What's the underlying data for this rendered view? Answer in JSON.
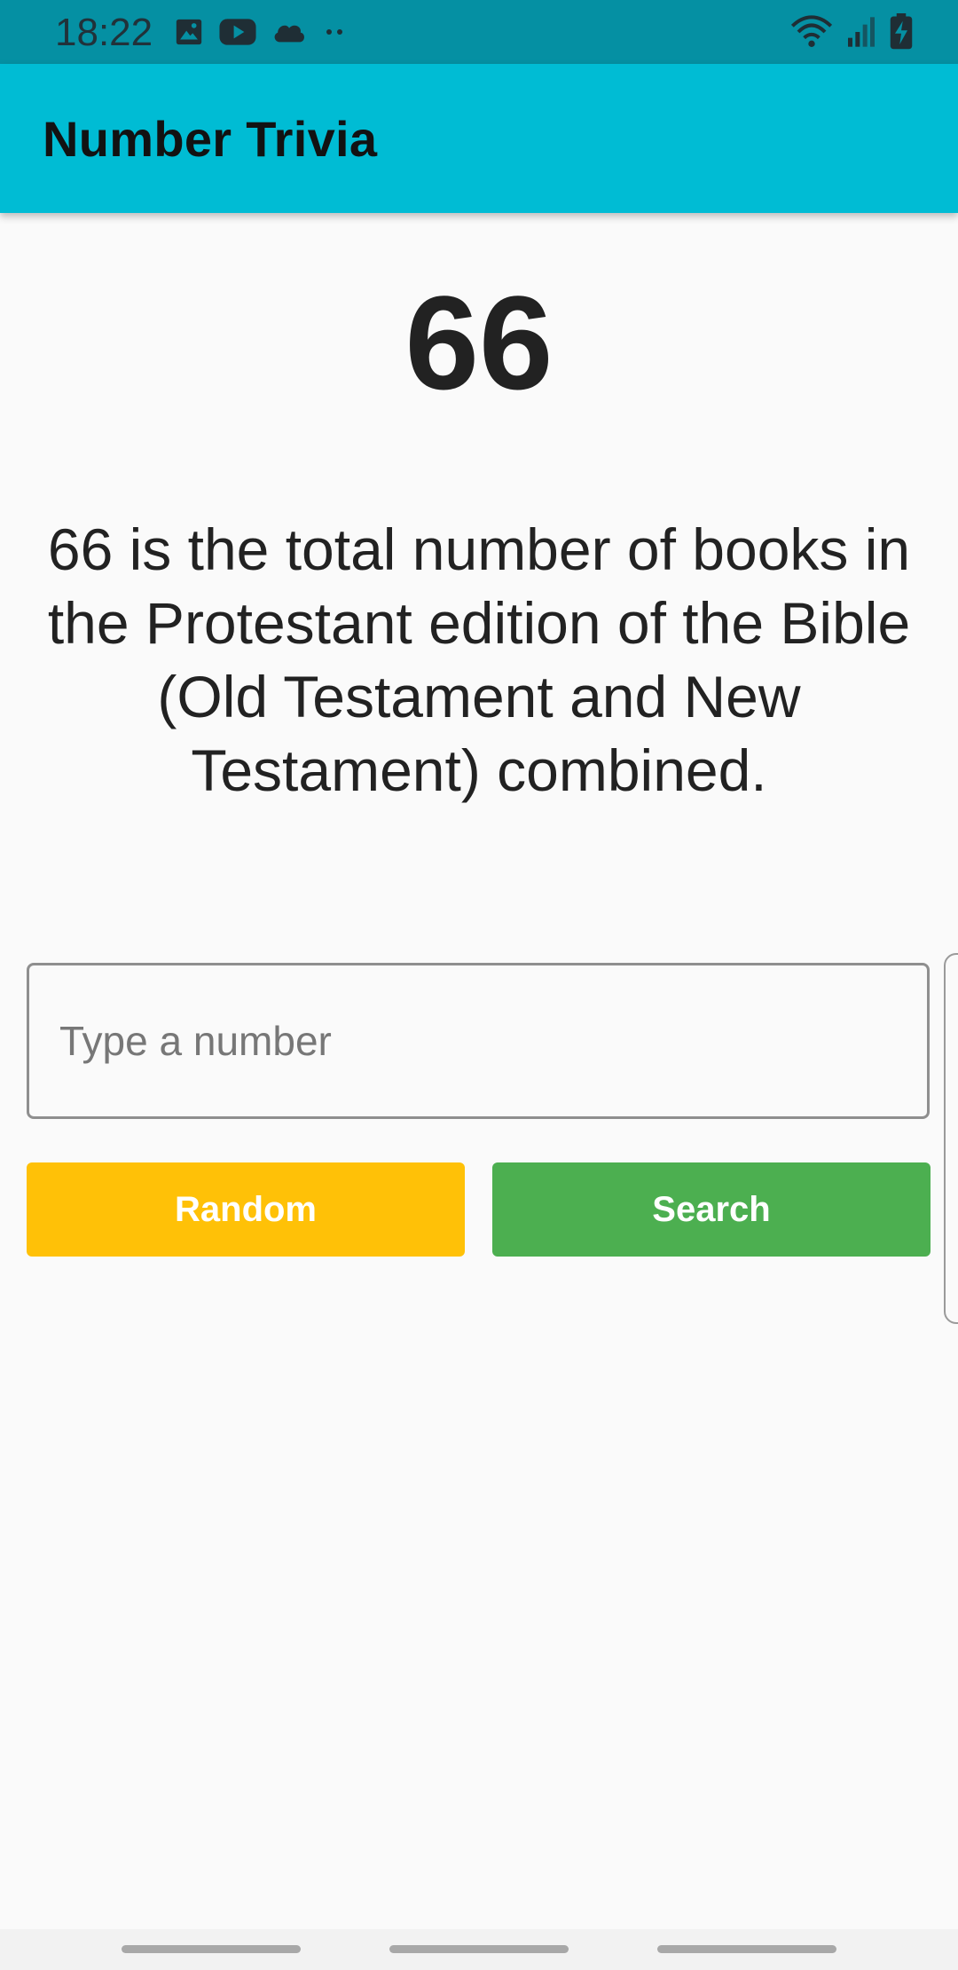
{
  "status_bar": {
    "time": "18:22",
    "left_icons": [
      "image-icon",
      "youtube-icon",
      "cloud-icon",
      "more-dots-icon"
    ],
    "right_icons": [
      "wifi-icon",
      "signal-icon",
      "battery-charging-icon"
    ]
  },
  "app_bar": {
    "title": "Number Trivia"
  },
  "trivia": {
    "number": "66",
    "text": "66 is the total number of books in the Protestant edition of the Bible (Old Testament and New Testament) combined."
  },
  "input": {
    "value": "",
    "placeholder": "Type a number"
  },
  "buttons": {
    "random_label": "Random",
    "search_label": "Search"
  },
  "colors": {
    "status_bar": "#0590a3",
    "app_bar": "#00bcd4",
    "random_button": "#ffc107",
    "search_button": "#4caf50",
    "background": "#fafafa"
  }
}
